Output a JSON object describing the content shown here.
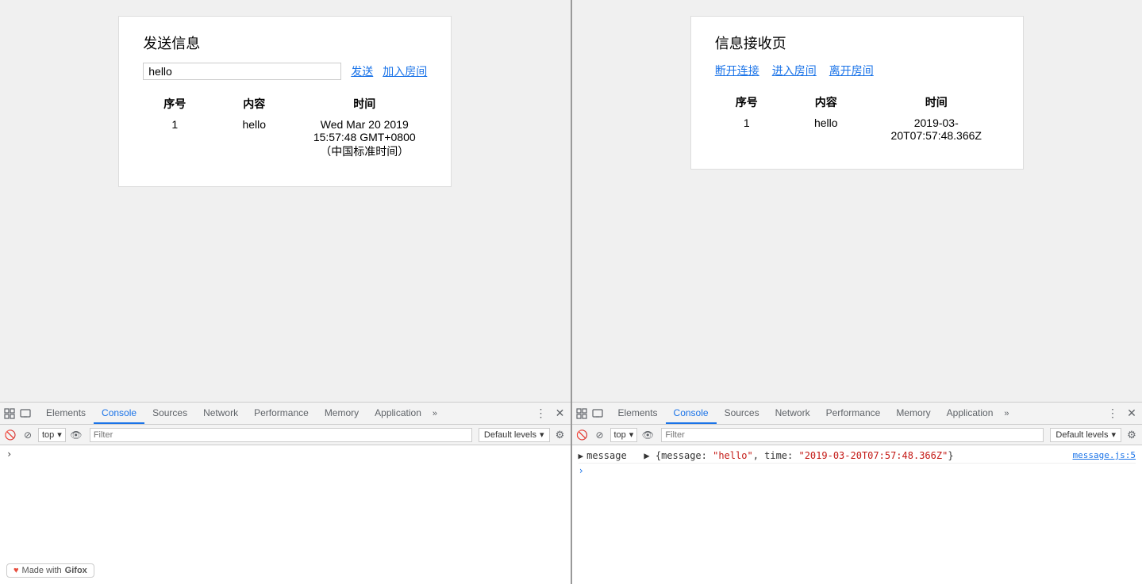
{
  "left_pane": {
    "page": {
      "title": "发送信息",
      "input_value": "hello",
      "send_btn": "发送",
      "join_btn": "加入房间",
      "table": {
        "col_seq": "序号",
        "col_content": "内容",
        "col_time": "时间",
        "rows": [
          {
            "seq": "1",
            "content": "hello",
            "time": "Wed Mar 20 2019 15:57:48 GMT+0800 （中国标准时间）"
          }
        ]
      }
    },
    "devtools": {
      "tabs": [
        "Elements",
        "Console",
        "Sources",
        "Network",
        "Performance",
        "Memory",
        "Application"
      ],
      "active_tab": "Console",
      "more_label": "»",
      "toolbar": {
        "context": "top",
        "filter_placeholder": "Filter",
        "levels_label": "Default levels",
        "levels_arrow": "▾"
      },
      "console_body": {
        "caret": "›",
        "prompt": "›"
      }
    }
  },
  "right_pane": {
    "page": {
      "title": "信息接收页",
      "disconnect_btn": "断开连接",
      "enter_btn": "进入房间",
      "leave_btn": "离开房间",
      "table": {
        "col_seq": "序号",
        "col_content": "内容",
        "col_time": "时间",
        "rows": [
          {
            "seq": "1",
            "content": "hello",
            "time": "2019-03-20T07:57:48.366Z"
          }
        ]
      }
    },
    "devtools": {
      "tabs": [
        "Elements",
        "Console",
        "Sources",
        "Network",
        "Performance",
        "Memory",
        "Application"
      ],
      "active_tab": "Console",
      "more_label": "»",
      "toolbar": {
        "context": "top",
        "filter_placeholder": "Filter",
        "levels_label": "Default levels",
        "levels_arrow": "▾"
      },
      "console_body": {
        "log_prefix": "message",
        "log_arrow": "▶",
        "log_content": "{message: \"hello\", time: \"2019-03-20T07:57:48.366Z\"}",
        "log_file": "message.js:5",
        "prompt": "›"
      }
    }
  },
  "gifox": {
    "label": "Made with",
    "brand": "Gifox"
  }
}
